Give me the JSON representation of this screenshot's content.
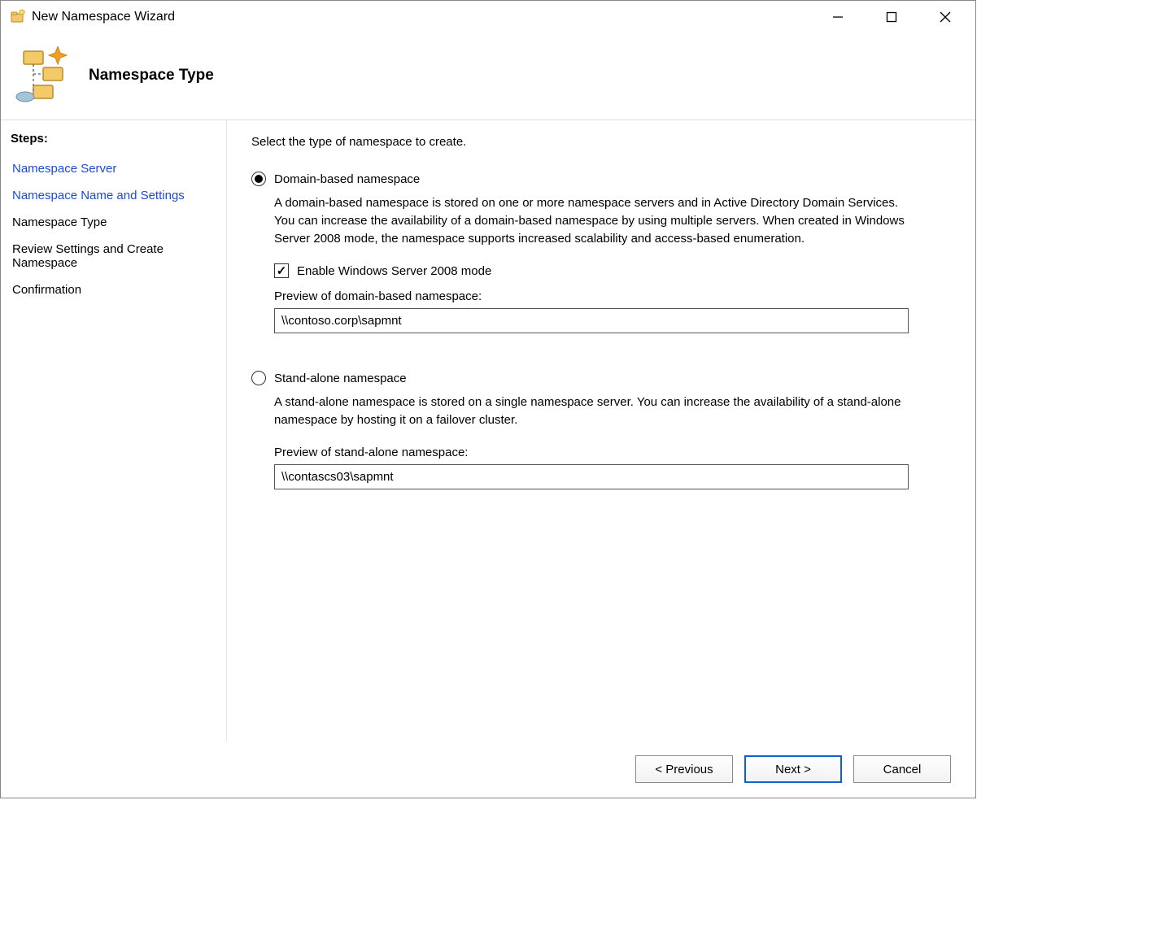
{
  "window": {
    "title": "New Namespace Wizard",
    "page_title": "Namespace Type"
  },
  "sidebar": {
    "steps_label": "Steps:",
    "items": [
      {
        "label": "Namespace Server",
        "state": "link"
      },
      {
        "label": "Namespace Name and Settings",
        "state": "link"
      },
      {
        "label": "Namespace Type",
        "state": "plain"
      },
      {
        "label": "Review Settings and Create Namespace",
        "state": "plain"
      },
      {
        "label": "Confirmation",
        "state": "plain"
      }
    ]
  },
  "content": {
    "prompt": "Select the type of namespace to create.",
    "domain": {
      "label": "Domain-based namespace",
      "selected": true,
      "description": "A domain-based namespace is stored on one or more namespace servers and in Active Directory Domain Services. You can increase the availability of a domain-based namespace by using multiple servers. When created in Windows Server 2008 mode, the namespace supports increased scalability and access-based enumeration.",
      "enable_2008_label": "Enable Windows Server 2008 mode",
      "enable_2008_checked": true,
      "preview_label": "Preview of domain-based namespace:",
      "preview_value": "\\\\contoso.corp\\sapmnt"
    },
    "standalone": {
      "label": "Stand-alone namespace",
      "selected": false,
      "description": "A stand-alone namespace is stored on a single namespace server. You can increase the availability of a stand-alone namespace by hosting it on a failover cluster.",
      "preview_label": "Preview of stand-alone namespace:",
      "preview_value": "\\\\contascs03\\sapmnt"
    }
  },
  "footer": {
    "previous": "< Previous",
    "next": "Next >",
    "cancel": "Cancel"
  }
}
